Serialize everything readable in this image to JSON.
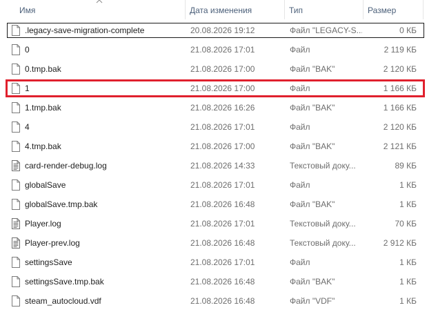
{
  "header": {
    "name_label": "Имя",
    "date_label": "Дата изменения",
    "type_label": "Тип",
    "size_label": "Размер"
  },
  "files": [
    {
      "name": ".legacy-save-migration-complete",
      "date": "20.08.2026 19:12",
      "type": "Файл \"LEGACY-S...",
      "size": "0 КБ",
      "icon": "file-icon",
      "state": "focused"
    },
    {
      "name": "0",
      "date": "21.08.2026 17:01",
      "type": "Файл",
      "size": "2 119 КБ",
      "icon": "file-icon",
      "state": ""
    },
    {
      "name": "0.tmp.bak",
      "date": "21.08.2026 17:00",
      "type": "Файл \"BAK\"",
      "size": "2 120 КБ",
      "icon": "file-icon",
      "state": ""
    },
    {
      "name": "1",
      "date": "21.08.2026 17:00",
      "type": "Файл",
      "size": "1 166 КБ",
      "icon": "file-icon",
      "state": "highlighted"
    },
    {
      "name": "1.tmp.bak",
      "date": "21.08.2026 16:26",
      "type": "Файл \"BAK\"",
      "size": "1 166 КБ",
      "icon": "file-icon",
      "state": ""
    },
    {
      "name": "4",
      "date": "21.08.2026 17:01",
      "type": "Файл",
      "size": "2 120 КБ",
      "icon": "file-icon",
      "state": ""
    },
    {
      "name": "4.tmp.bak",
      "date": "21.08.2026 17:00",
      "type": "Файл \"BAK\"",
      "size": "2 121 КБ",
      "icon": "file-icon",
      "state": ""
    },
    {
      "name": "card-render-debug.log",
      "date": "21.08.2026 14:33",
      "type": "Текстовый доку...",
      "size": "89 КБ",
      "icon": "text-file-icon",
      "state": ""
    },
    {
      "name": "globalSave",
      "date": "21.08.2026 17:01",
      "type": "Файл",
      "size": "1 КБ",
      "icon": "file-icon",
      "state": ""
    },
    {
      "name": "globalSave.tmp.bak",
      "date": "21.08.2026 16:48",
      "type": "Файл \"BAK\"",
      "size": "1 КБ",
      "icon": "file-icon",
      "state": ""
    },
    {
      "name": "Player.log",
      "date": "21.08.2026 17:01",
      "type": "Текстовый доку...",
      "size": "70 КБ",
      "icon": "text-file-icon",
      "state": ""
    },
    {
      "name": "Player-prev.log",
      "date": "21.08.2026 16:48",
      "type": "Текстовый доку...",
      "size": "2 912 КБ",
      "icon": "text-file-icon",
      "state": ""
    },
    {
      "name": "settingsSave",
      "date": "21.08.2026 17:01",
      "type": "Файл",
      "size": "1 КБ",
      "icon": "file-icon",
      "state": ""
    },
    {
      "name": "settingsSave.tmp.bak",
      "date": "21.08.2026 16:48",
      "type": "Файл \"BAK\"",
      "size": "1 КБ",
      "icon": "file-icon",
      "state": ""
    },
    {
      "name": "steam_autocloud.vdf",
      "date": "21.08.2026 16:48",
      "type": "Файл \"VDF\"",
      "size": "1 КБ",
      "icon": "file-icon",
      "state": ""
    }
  ],
  "colors": {
    "header_text": "#4c607a",
    "highlight_border": "#e0202d",
    "secondary_text": "#6d6d6d"
  }
}
